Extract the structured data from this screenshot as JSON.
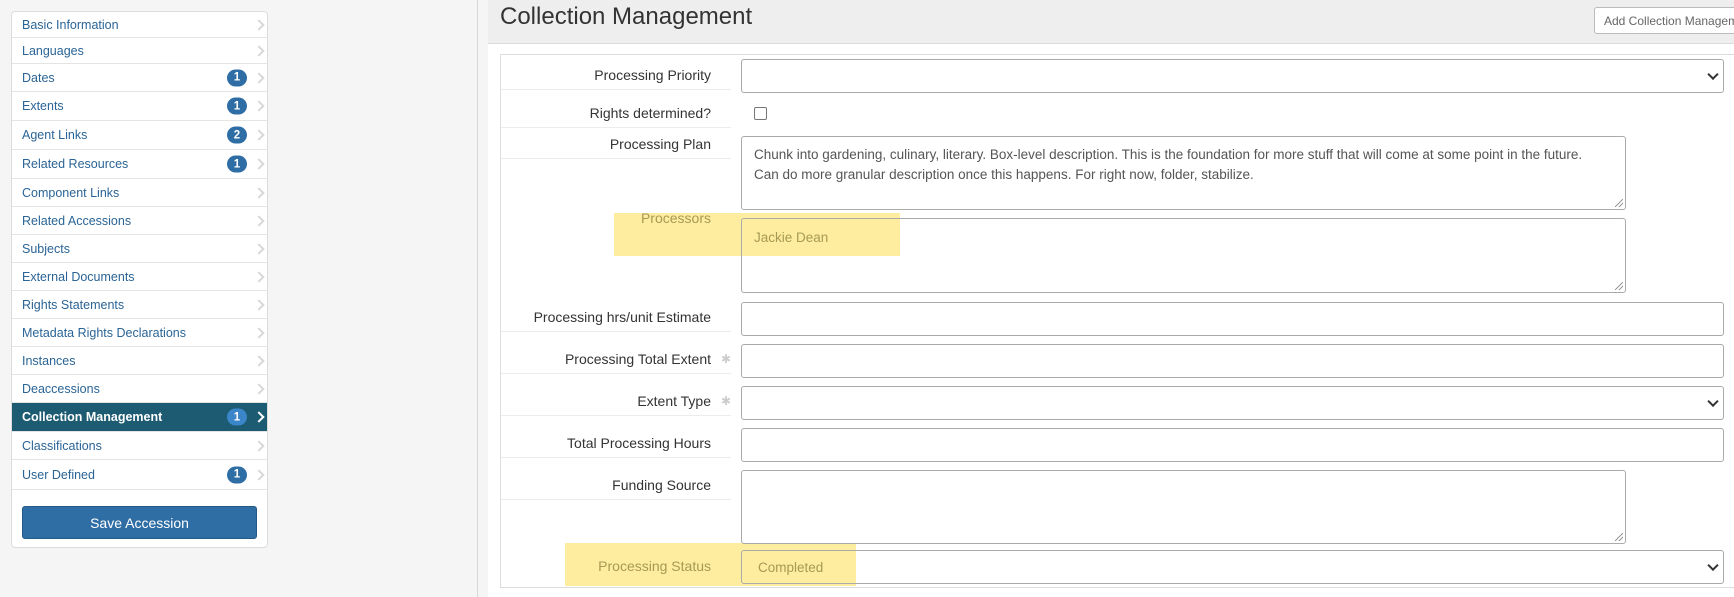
{
  "sidebar": {
    "items": [
      {
        "label": "Basic Information",
        "badge": ""
      },
      {
        "label": "Languages",
        "badge": ""
      },
      {
        "label": "Dates",
        "badge": "1"
      },
      {
        "label": "Extents",
        "badge": "1"
      },
      {
        "label": "Agent Links",
        "badge": "2"
      },
      {
        "label": "Related Resources",
        "badge": "1"
      },
      {
        "label": "Component Links",
        "badge": ""
      },
      {
        "label": "Related Accessions",
        "badge": ""
      },
      {
        "label": "Subjects",
        "badge": ""
      },
      {
        "label": "External Documents",
        "badge": ""
      },
      {
        "label": "Rights Statements",
        "badge": ""
      },
      {
        "label": "Metadata Rights Declarations",
        "badge": ""
      },
      {
        "label": "Instances",
        "badge": ""
      },
      {
        "label": "Deaccessions",
        "badge": ""
      },
      {
        "label": "Collection Management",
        "badge": "1",
        "active": true
      },
      {
        "label": "Classifications",
        "badge": ""
      },
      {
        "label": "User Defined",
        "badge": "1"
      }
    ],
    "save_label": "Save Accession"
  },
  "main": {
    "title": "Collection Management",
    "add_button_label": "Add Collection Management"
  },
  "form": {
    "processing_priority": {
      "label": "Processing Priority",
      "value": ""
    },
    "rights_determined": {
      "label": "Rights determined?",
      "checked": false
    },
    "processing_plan": {
      "label": "Processing Plan",
      "value": "Chunk into gardening, culinary, literary. Box-level description. This is the foundation for more stuff that will come at some point in the future. Can do more granular description once this happens. For right now, folder, stabilize."
    },
    "processors": {
      "label": "Processors",
      "value": "Jackie Dean"
    },
    "processing_hrs_unit_estimate": {
      "label": "Processing hrs/unit Estimate",
      "value": ""
    },
    "processing_total_extent": {
      "label": "Processing Total Extent",
      "value": "",
      "required_mark": "✱"
    },
    "extent_type": {
      "label": "Extent Type",
      "value": "",
      "required_mark": "✱"
    },
    "total_processing_hours": {
      "label": "Total Processing Hours",
      "value": ""
    },
    "funding_source": {
      "label": "Funding Source",
      "value": ""
    },
    "processing_status": {
      "label": "Processing Status",
      "value": "Completed"
    }
  },
  "colors": {
    "active_nav": "#1c5b72",
    "badge": "#2f6ea5",
    "primary_button": "#2f6ea5",
    "highlight": "#ffde50"
  }
}
